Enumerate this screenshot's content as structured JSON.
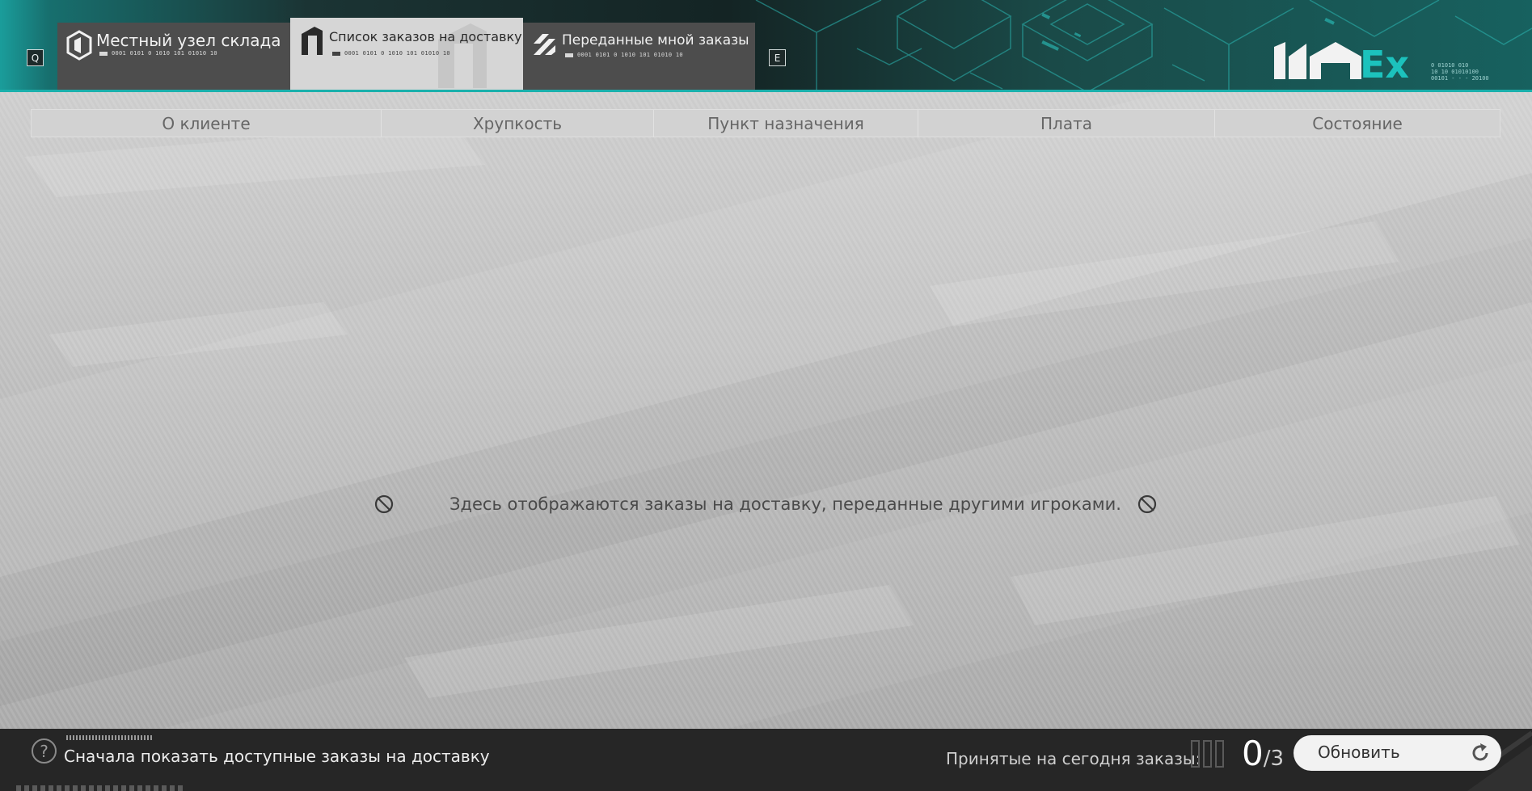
{
  "keys": {
    "prev_tab": "Q",
    "next_tab": "E"
  },
  "tabs": [
    {
      "label": "Местный узел склада",
      "code": "0001 0101 0 1010 101 01010 10",
      "icon": "warehouse-node-icon",
      "active": false
    },
    {
      "label": "Список заказов на доставку",
      "code": "0001 0101 0 1010 101 01010 10",
      "icon": "delivery-list-icon",
      "active": true
    },
    {
      "label": "Переданные мной заказы",
      "code": "0001 0101 0 1010 101 01010 10",
      "icon": "transferred-orders-icon",
      "active": false
    }
  ],
  "logo": {
    "text": "Ex",
    "code_lines": [
      "0 01010 010",
      "10 10 01010100",
      "00101 - - - 20100"
    ]
  },
  "columns": [
    "О клиенте",
    "Хрупкость",
    "Пункт назначения",
    "Плата",
    "Состояние"
  ],
  "empty_state": {
    "message": "Здесь отображаются заказы на доставку, переданные другими игроками.",
    "icon": "no-orders-icon"
  },
  "bottom": {
    "help_icon_text": "?",
    "filter_label": "Сначала показать доступные заказы на доставку",
    "accepted_label": "Принятые на сегодня заказы:",
    "accepted_current": "0",
    "accepted_sep": "/",
    "accepted_max": "3",
    "refresh_label": "Обновить"
  },
  "colors": {
    "accent": "#1ab0ac",
    "active_tab": "#d6d6d6",
    "inactive_tab": "#4d4d4d",
    "bottom_bar": "#262626"
  }
}
